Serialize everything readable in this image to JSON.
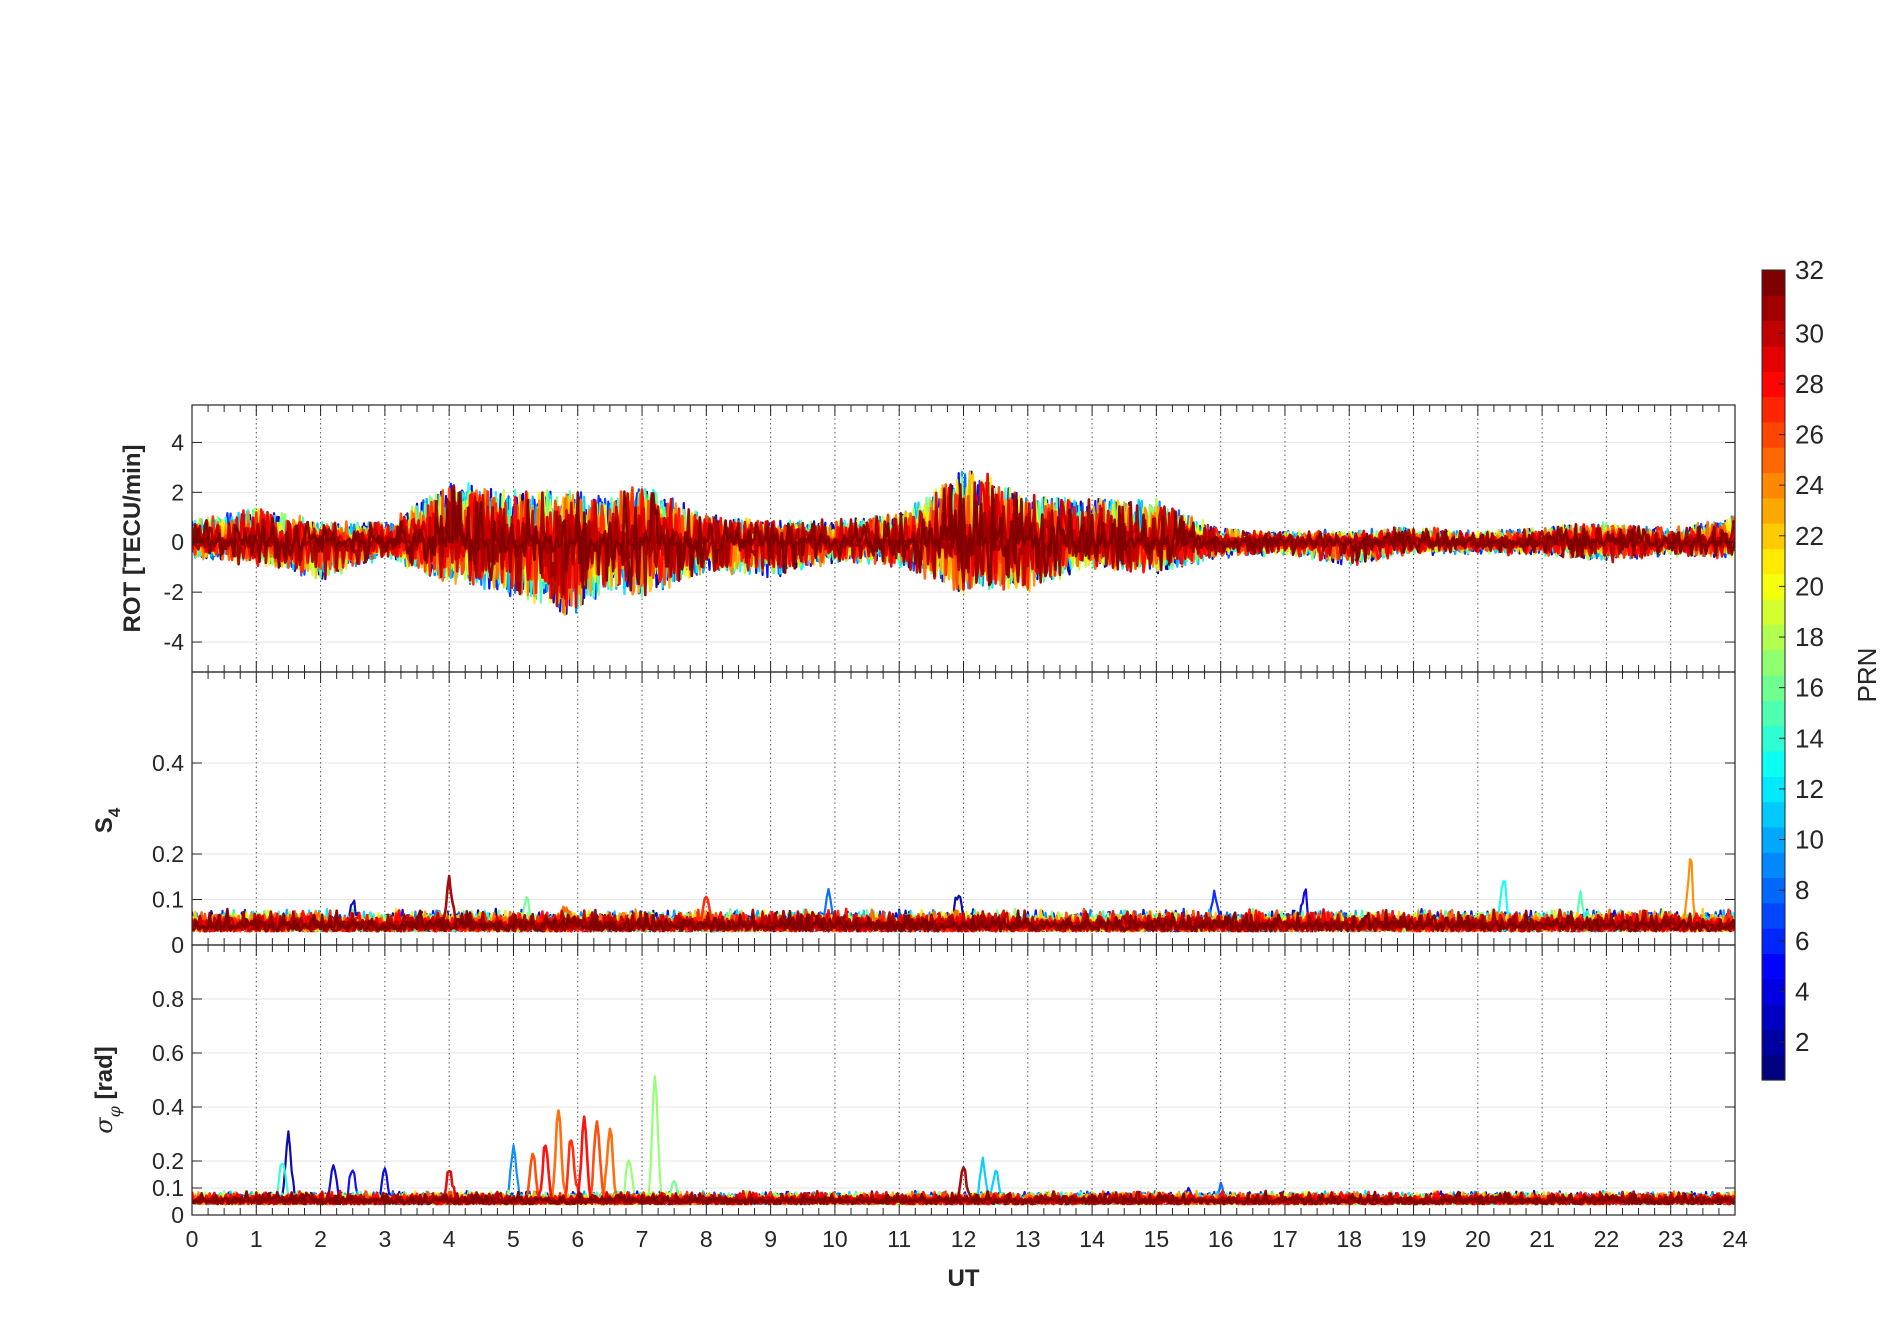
{
  "chart_data": [
    {
      "type": "line",
      "panel": "ROT",
      "ylabel": "ROT [TECU/min]",
      "xlim": [
        0,
        24
      ],
      "ylim": [
        -5.2,
        5.5
      ],
      "yticks": [
        -4,
        -2,
        0,
        2,
        4
      ],
      "grid": "on",
      "series_note": "32 PRN traces (PRN 1-32), colored by PRN",
      "envelope": {
        "x": [
          0,
          1,
          2,
          3,
          4,
          5,
          5.8,
          6.5,
          7,
          8,
          9,
          10,
          11,
          12,
          12.3,
          13,
          14,
          15,
          16,
          17,
          18,
          19,
          20,
          21,
          22,
          23,
          24
        ],
        "max": [
          0.9,
          1.5,
          0.8,
          0.8,
          2.6,
          2.2,
          2.3,
          2.0,
          2.6,
          1.1,
          0.9,
          0.9,
          1.2,
          3.2,
          3.0,
          2.0,
          1.9,
          1.8,
          0.5,
          0.4,
          0.4,
          0.6,
          0.4,
          0.6,
          0.8,
          0.5,
          1.1
        ],
        "min": [
          -0.6,
          -0.9,
          -1.6,
          -0.6,
          -1.7,
          -2.3,
          -3.3,
          -2.0,
          -2.5,
          -1.3,
          -1.5,
          -0.8,
          -1.0,
          -2.3,
          -2.0,
          -2.1,
          -1.0,
          -1.3,
          -0.6,
          -0.4,
          -1.0,
          -0.4,
          -0.4,
          -0.5,
          -0.8,
          -0.5,
          -0.6
        ]
      }
    },
    {
      "type": "line",
      "panel": "S4",
      "ylabel": "S4",
      "xlim": [
        0,
        24
      ],
      "ylim": [
        0,
        0.6
      ],
      "yticks": [
        0,
        0.1,
        0.2,
        0.4
      ],
      "grid": "on",
      "series_note": "32 PRN traces (PRN 1-32), colored by PRN",
      "baseline": 0.04,
      "peaks": [
        {
          "x": 2.5,
          "y": 0.09,
          "prn": 3
        },
        {
          "x": 4.0,
          "y": 0.13,
          "prn": 31
        },
        {
          "x": 5.2,
          "y": 0.1,
          "prn": 16
        },
        {
          "x": 5.8,
          "y": 0.08,
          "prn": 25
        },
        {
          "x": 8.0,
          "y": 0.1,
          "prn": 27
        },
        {
          "x": 9.9,
          "y": 0.12,
          "prn": 8
        },
        {
          "x": 11.9,
          "y": 0.11,
          "prn": 2
        },
        {
          "x": 15.9,
          "y": 0.11,
          "prn": 6
        },
        {
          "x": 17.3,
          "y": 0.11,
          "prn": 4
        },
        {
          "x": 20.4,
          "y": 0.14,
          "prn": 13
        },
        {
          "x": 21.6,
          "y": 0.1,
          "prn": 15
        },
        {
          "x": 23.3,
          "y": 0.17,
          "prn": 24
        }
      ]
    },
    {
      "type": "line",
      "panel": "sigma_phi",
      "ylabel": "σφ [rad]",
      "xlim": [
        0,
        24
      ],
      "ylim": [
        0,
        1.0
      ],
      "yticks": [
        0,
        0.1,
        0.2,
        0.4,
        0.6,
        0.8
      ],
      "grid": "on",
      "series_note": "32 PRN traces (PRN 1-32), colored by PRN",
      "baseline": 0.05,
      "peaks": [
        {
          "x": 1.5,
          "y": 0.29,
          "prn": 2
        },
        {
          "x": 1.4,
          "y": 0.2,
          "prn": 14
        },
        {
          "x": 2.2,
          "y": 0.19,
          "prn": 3
        },
        {
          "x": 2.5,
          "y": 0.17,
          "prn": 5
        },
        {
          "x": 3.0,
          "y": 0.17,
          "prn": 4
        },
        {
          "x": 4.0,
          "y": 0.17,
          "prn": 29
        },
        {
          "x": 5.0,
          "y": 0.25,
          "prn": 9
        },
        {
          "x": 5.3,
          "y": 0.22,
          "prn": 26
        },
        {
          "x": 5.5,
          "y": 0.26,
          "prn": 28
        },
        {
          "x": 5.7,
          "y": 0.39,
          "prn": 25
        },
        {
          "x": 5.9,
          "y": 0.28,
          "prn": 27
        },
        {
          "x": 6.1,
          "y": 0.35,
          "prn": 28
        },
        {
          "x": 6.3,
          "y": 0.34,
          "prn": 26
        },
        {
          "x": 6.5,
          "y": 0.32,
          "prn": 25
        },
        {
          "x": 6.8,
          "y": 0.21,
          "prn": 17
        },
        {
          "x": 7.2,
          "y": 0.51,
          "prn": 17
        },
        {
          "x": 7.5,
          "y": 0.12,
          "prn": 16
        },
        {
          "x": 12.0,
          "y": 0.17,
          "prn": 31
        },
        {
          "x": 12.3,
          "y": 0.2,
          "prn": 11
        },
        {
          "x": 12.5,
          "y": 0.16,
          "prn": 11
        },
        {
          "x": 15.5,
          "y": 0.1,
          "prn": 4
        },
        {
          "x": 16.0,
          "y": 0.1,
          "prn": 8
        }
      ]
    }
  ],
  "x_axis": {
    "label": "UT",
    "ticks": [
      0,
      1,
      2,
      3,
      4,
      5,
      6,
      7,
      8,
      9,
      10,
      11,
      12,
      13,
      14,
      15,
      16,
      17,
      18,
      19,
      20,
      21,
      22,
      23,
      24
    ]
  },
  "colorbar": {
    "label": "PRN",
    "colormap": "jet",
    "range": [
      1,
      32
    ],
    "ticks": [
      2,
      4,
      6,
      8,
      10,
      12,
      14,
      16,
      18,
      20,
      22,
      24,
      26,
      28,
      30,
      32
    ]
  },
  "colors": {
    "axis": "#262626",
    "grid": "#e6e6e6",
    "vgrid": "#555555"
  }
}
